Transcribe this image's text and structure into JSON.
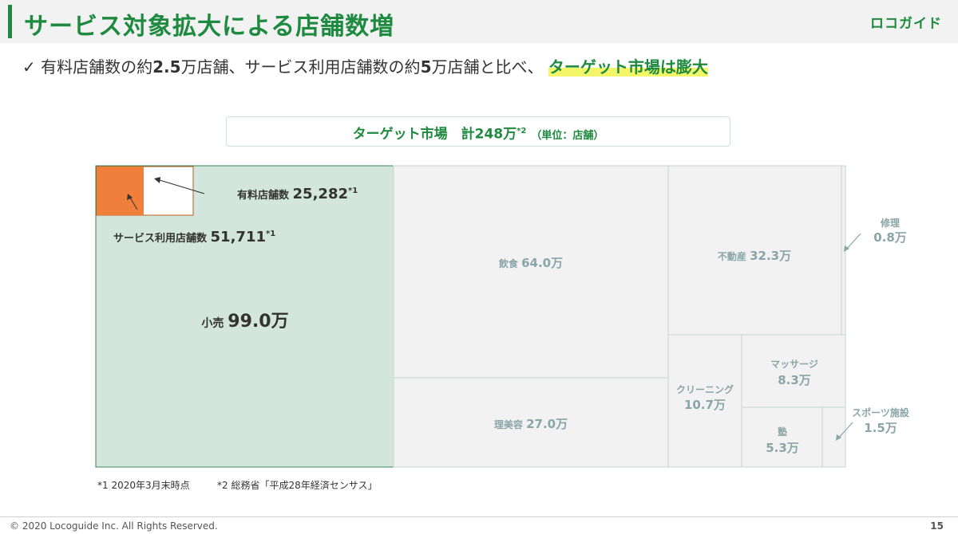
{
  "slide": {
    "title": "サービス対象拡大による店舗数増",
    "logo": "ロコガイド",
    "check_mark": "✓",
    "subline_part1": "有料店舗数の約",
    "subline_num1": "2.5",
    "subline_part2": "万店舗、サービス利用店舗数の約",
    "subline_num2": "5",
    "subline_part3": "万店舗と比べ、",
    "subline_highlight": "ターゲット市場は膨大",
    "market_prefix": "ターゲット市場　計248万",
    "market_sup": "*2",
    "market_unit": "（単位：店舗）",
    "footnote1": "*1 2020年3月末時点",
    "footnote2": "*2 総務省「平成28年経済センサス」",
    "copyright": "© 2020 Locoguide Inc. All Rights Reserved.",
    "page_number": "15"
  },
  "colors": {
    "brand_green": "#1d8a3f",
    "retail_fill": "#d3e6dc",
    "cell_fill": "#f2f2f2",
    "paid_fill": "#ef7f3a",
    "label_gray": "#8aa5a8",
    "highlight": "#f4f66a"
  },
  "chart_data": {
    "type": "treemap",
    "title": "ターゲット市場　計248万",
    "unit": "万",
    "total": 248,
    "cells": [
      {
        "name": "小売",
        "value": 99.0,
        "value_label": "99.0万"
      },
      {
        "name": "飲食",
        "value": 64.0,
        "value_label": "64.0万"
      },
      {
        "name": "理美容",
        "value": 27.0,
        "value_label": "27.0万"
      },
      {
        "name": "不動産",
        "value": 32.3,
        "value_label": "32.3万"
      },
      {
        "name": "修理",
        "value": 0.8,
        "value_label": "0.8万"
      },
      {
        "name": "クリーニング",
        "value": 10.7,
        "value_label": "10.7万"
      },
      {
        "name": "マッサージ",
        "value": 8.3,
        "value_label": "8.3万"
      },
      {
        "name": "塾",
        "value": 5.3,
        "value_label": "5.3万"
      },
      {
        "name": "スポーツ施設",
        "value": 1.5,
        "value_label": "1.5万"
      }
    ],
    "annotations": [
      {
        "name": "有料店舗数",
        "value": 25282,
        "value_label": "25,282",
        "note": "*1"
      },
      {
        "name": "サービス利用店舗数",
        "value": 51711,
        "value_label": "51,711",
        "note": "*1"
      }
    ]
  }
}
